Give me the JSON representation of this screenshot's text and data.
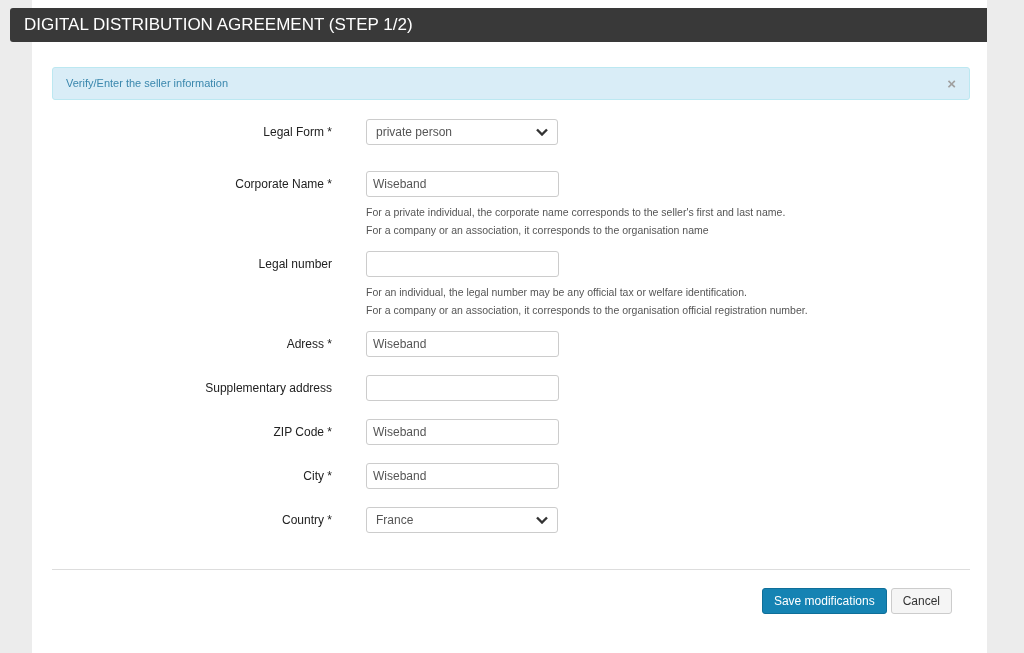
{
  "header": {
    "title": "DIGITAL DISTRIBUTION AGREEMENT (STEP 1/2)"
  },
  "alert": {
    "text": "Verify/Enter the seller information",
    "close": "×"
  },
  "fields": [
    {
      "kind": "select",
      "label": "Legal Form *",
      "value": "private person"
    },
    {
      "kind": "text",
      "label": "Corporate Name *",
      "value": "Wiseband",
      "help": [
        "For a private individual, the corporate name corresponds to the seller's first and last name.",
        "For a company or an association, it corresponds to the organisation name"
      ]
    },
    {
      "kind": "text",
      "label": "Legal number",
      "help": [
        "For an individual, the legal number may be any official tax or welfare identification.",
        "For a company or an association, it corresponds to the organisation official registration number."
      ]
    },
    {
      "kind": "text",
      "label": "Adress *",
      "value": "Wiseband"
    },
    {
      "kind": "text",
      "label": "Supplementary address"
    },
    {
      "kind": "text",
      "label": "ZIP Code *",
      "value": "Wiseband"
    },
    {
      "kind": "text",
      "label": "City *",
      "value": "Wiseband"
    },
    {
      "kind": "select",
      "label": "Country *",
      "value": "France"
    }
  ],
  "buttons": [
    {
      "kind": "primary",
      "label": "Save modifications"
    },
    {
      "kind": "default",
      "label": "Cancel"
    }
  ]
}
